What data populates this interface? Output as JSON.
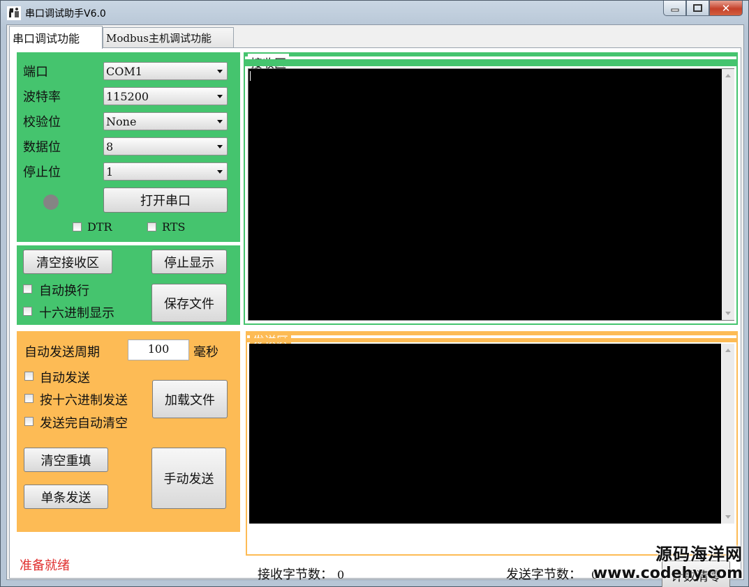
{
  "window": {
    "title": "串口调试助手V6.0",
    "close_glyph": "✕"
  },
  "tabs": [
    {
      "label": "串口调试功能",
      "active": true
    },
    {
      "label": "Modbus主机调试功能",
      "active": false
    }
  ],
  "serial": {
    "port_label": "端口",
    "port_value": "COM1",
    "baud_label": "波特率",
    "baud_value": "115200",
    "parity_label": "校验位",
    "parity_value": "None",
    "databits_label": "数据位",
    "databits_value": "8",
    "stopbits_label": "停止位",
    "stopbits_value": "1",
    "open_button": "打开串口",
    "dtr_label": "DTR",
    "rts_label": "RTS",
    "led_color": "#848484"
  },
  "receive_opts": {
    "clear_button": "清空接收区",
    "stop_button": "停止显示",
    "save_button": "保存文件",
    "auto_wrap_label": "自动换行",
    "hex_display_label": "十六进制显示"
  },
  "send_opts": {
    "period_label": "自动发送周期",
    "period_value": "100",
    "period_unit": "毫秒",
    "auto_send_label": "自动发送",
    "hex_send_label": "按十六进制发送",
    "auto_clear_label": "发送完自动清空",
    "load_button": "加载文件",
    "clear_refill_button": "清空重填",
    "single_send_button": "单条发送",
    "manual_send_button": "手动发送"
  },
  "receive_area": {
    "legend": "接收区"
  },
  "send_area": {
    "legend": "发送区"
  },
  "footer": {
    "status": "准备就绪",
    "recv_count_label": "接收字节数：",
    "recv_count_value": "0",
    "send_count_label": "发送字节数：",
    "send_count_value": "0",
    "reset_button": "计数清零"
  },
  "watermark": {
    "line1": "源码海洋网",
    "line2": "www.codehy.com"
  },
  "colors": {
    "green_panel": "#45c46e",
    "orange_panel": "#fdbb55",
    "status_red": "#e0302f"
  }
}
